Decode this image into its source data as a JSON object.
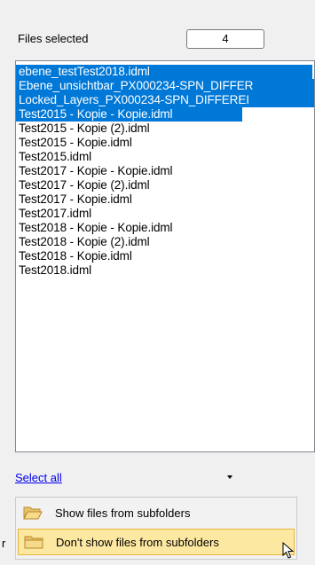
{
  "header": {
    "files_label": "Files selected",
    "count_value": "4"
  },
  "files": [
    {
      "name": "ebene_testTest2018.idml",
      "selected": true
    },
    {
      "name": "Ebene_unsichtbar_PX000234-SPN_DIFFER",
      "selected": true
    },
    {
      "name": "Locked_Layers_PX000234-SPN_DIFFEREI",
      "selected": true
    },
    {
      "name": "Test2015 - Kopie - Kopie.idml",
      "selected": true
    },
    {
      "name": "Test2015 - Kopie (2).idml",
      "selected": false
    },
    {
      "name": "Test2015 - Kopie.idml",
      "selected": false
    },
    {
      "name": "Test2015.idml",
      "selected": false
    },
    {
      "name": "Test2017 - Kopie - Kopie.idml",
      "selected": false
    },
    {
      "name": "Test2017 - Kopie (2).idml",
      "selected": false
    },
    {
      "name": "Test2017 - Kopie.idml",
      "selected": false
    },
    {
      "name": "Test2017.idml",
      "selected": false
    },
    {
      "name": "Test2018 - Kopie - Kopie.idml",
      "selected": false
    },
    {
      "name": "Test2018 - Kopie (2).idml",
      "selected": false
    },
    {
      "name": "Test2018 - Kopie.idml",
      "selected": false
    },
    {
      "name": "Test2018.idml",
      "selected": false
    }
  ],
  "footer": {
    "select_all_label": "Select all"
  },
  "menu": {
    "items": [
      {
        "label": "Show files from subfolders",
        "icon": "folder-open-icon"
      },
      {
        "label": "Don't show files from subfolders",
        "icon": "folder-icon",
        "highlighted": true
      }
    ]
  },
  "clipped_text": "r",
  "colors": {
    "selection": "#0078d7",
    "menu_highlight": "#fde8a2",
    "link": "#0000ee"
  }
}
